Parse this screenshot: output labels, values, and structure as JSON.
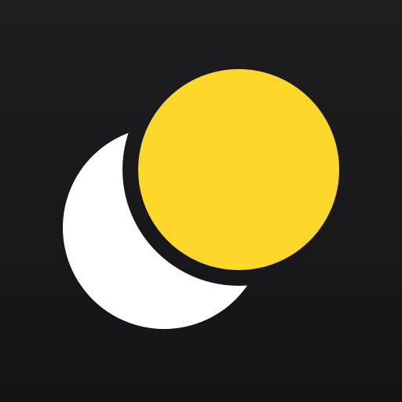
{
  "icon": {
    "name": "sun-and-moon-app-icon",
    "background_color": "#1a1a1c",
    "moon_color": "#ffffff",
    "sun_color": "#fdd72a"
  }
}
